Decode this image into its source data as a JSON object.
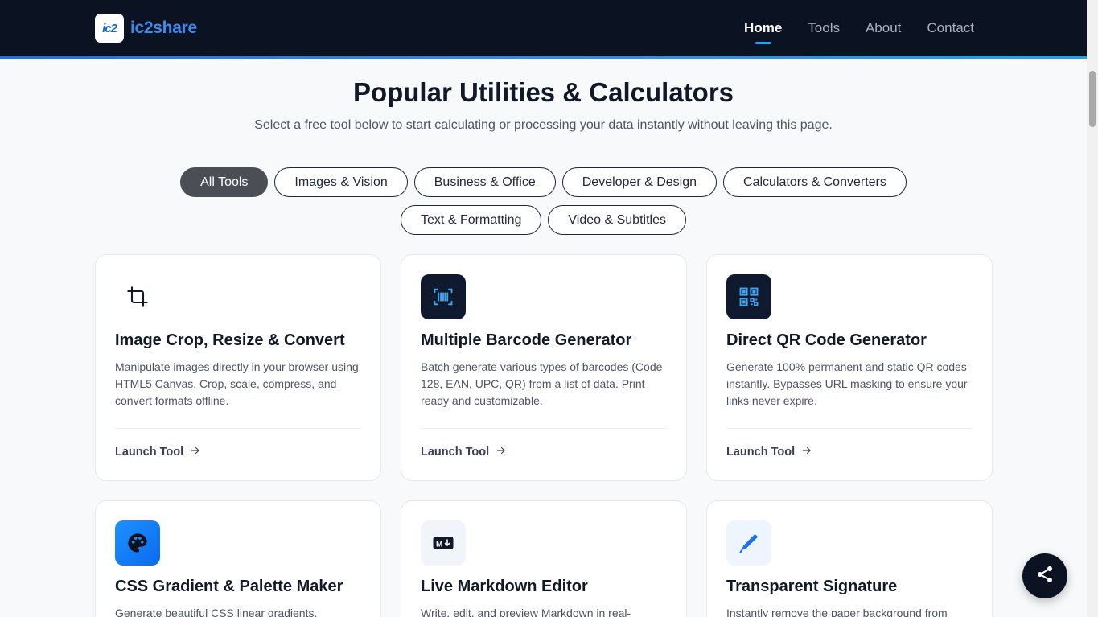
{
  "brand": {
    "logo_mark": "ic2",
    "name": "ic2share"
  },
  "nav": {
    "items": [
      "Home",
      "Tools",
      "About",
      "Contact"
    ],
    "active": "Home"
  },
  "hero": {
    "title": "Popular Utilities & Calculators",
    "subtitle": "Select a free tool below to start calculating or processing your data instantly without leaving this page."
  },
  "filters": [
    "All Tools",
    "Images & Vision",
    "Business & Office",
    "Developer & Design",
    "Calculators & Converters",
    "Text & Formatting",
    "Video & Subtitles"
  ],
  "active_filter": "All Tools",
  "cards": [
    {
      "title": "Image Crop, Resize & Convert",
      "desc": "Manipulate images directly in your browser using HTML5 Canvas. Crop, scale, compress, and convert formats offline.",
      "launch": "Launch Tool",
      "icon": "crop-icon"
    },
    {
      "title": "Multiple Barcode Generator",
      "desc": "Batch generate various types of barcodes (Code 128, EAN, UPC, QR) from a list of data. Print ready and customizable.",
      "launch": "Launch Tool",
      "icon": "barcode-icon"
    },
    {
      "title": "Direct QR Code Generator",
      "desc": "Generate 100% permanent and static QR codes instantly. Bypasses URL masking to ensure your links never expire.",
      "launch": "Launch Tool",
      "icon": "qr-code-icon"
    },
    {
      "title": "CSS Gradient & Palette Maker",
      "desc": "Generate beautiful CSS linear gradients.",
      "icon": "palette-icon"
    },
    {
      "title": "Live Markdown Editor",
      "desc": "Write, edit, and preview Markdown in real-",
      "icon": "markdown-icon"
    },
    {
      "title": "Transparent Signature",
      "desc": "Instantly remove the paper background from",
      "icon": "pen-icon"
    }
  ],
  "colors": {
    "header_bg": "#0b1221",
    "accent": "#22a3f2",
    "brand_blue": "#3b8cf0",
    "active_pill": "#4b4f55"
  }
}
